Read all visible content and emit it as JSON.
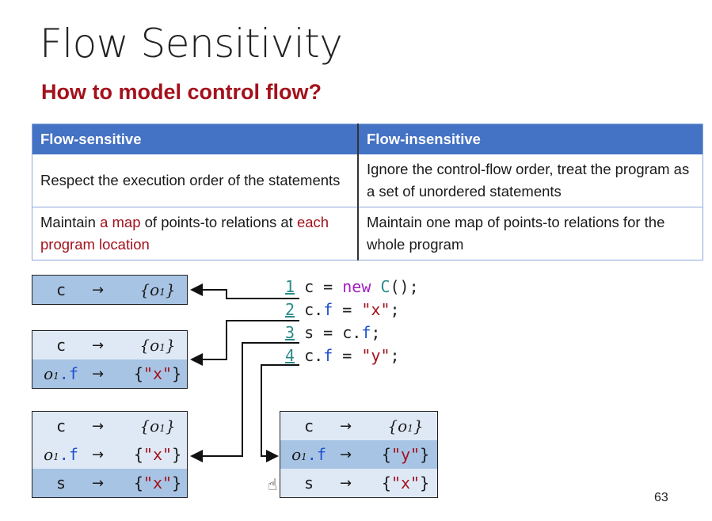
{
  "title": "Flow Sensitivity",
  "subtitle": "How to model control flow?",
  "table": {
    "headers": [
      "Flow-sensitive",
      "Flow-insensitive"
    ],
    "rows": [
      {
        "left": "Respect the execution order of the statements",
        "right": "Ignore the control-flow order, treat the program as a set of unordered statements"
      },
      {
        "left_prefix": "Maintain ",
        "left_highlight1": "a map",
        "left_middle": " of points-to relations at ",
        "left_highlight2": "each program location",
        "right": "Maintain one map of points-to relations for the whole program"
      }
    ]
  },
  "code": {
    "lines": [
      {
        "num": "1",
        "text_parts": [
          "c = ",
          "new",
          " ",
          "C",
          "();"
        ]
      },
      {
        "num": "2",
        "text_parts": [
          "c.",
          "f",
          " = ",
          "\"x\"",
          ";"
        ]
      },
      {
        "num": "3",
        "text_parts": [
          "s = c.",
          "f",
          ";"
        ]
      },
      {
        "num": "4",
        "text_parts": [
          "c.",
          "f",
          " = ",
          "\"y\"",
          ";"
        ]
      }
    ]
  },
  "points_to": {
    "arrow": "→",
    "box1": [
      {
        "key": "c",
        "val_obj": "o",
        "val_sub": "1"
      }
    ],
    "box2": [
      {
        "key": "c",
        "val_obj": "o",
        "val_sub": "1"
      },
      {
        "key_obj": "o",
        "key_sub": "1",
        "key_field": ".f",
        "val_str": "\"x\""
      }
    ],
    "box3": [
      {
        "key": "c",
        "val_obj": "o",
        "val_sub": "1"
      },
      {
        "key_obj": "o",
        "key_sub": "1",
        "key_field": ".f",
        "val_str": "\"x\""
      },
      {
        "key": "s",
        "val_str": "\"x\""
      }
    ],
    "box4": [
      {
        "key": "c",
        "val_obj": "o",
        "val_sub": "1"
      },
      {
        "key_obj": "o",
        "key_sub": "1",
        "key_field": ".f",
        "val_str": "\"y\""
      },
      {
        "key": "s",
        "val_str": "\"x\""
      }
    ]
  },
  "page_number": "63"
}
